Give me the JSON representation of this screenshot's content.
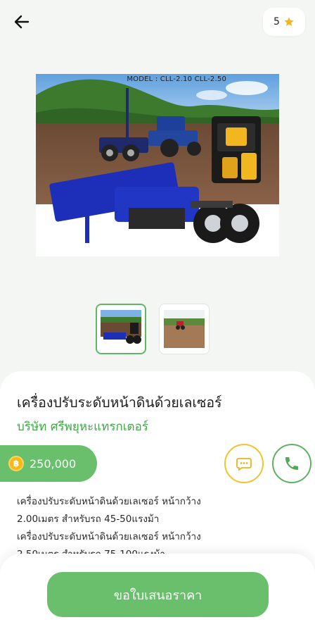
{
  "header": {
    "back_icon": "arrow-left-icon",
    "rating": "5",
    "rating_icon": "star-icon",
    "star_color": "#f2b71f"
  },
  "gallery": {
    "main_image_caption": "MODEL : CLL-2.10   CLL-2.50",
    "thumbnails": [
      {
        "name": "thumbnail-1",
        "active": true
      },
      {
        "name": "thumbnail-2",
        "active": false
      }
    ],
    "active_border_color": "#62b567"
  },
  "product": {
    "title": "เครื่องปรับระดับหน้าดินด้วยเลเซอร์",
    "company": "บริษัท ศรีพยุหะแทรกเตอร์",
    "price": "250,000",
    "price_icon": "coin-icon",
    "description_lines": [
      "เครื่องปรับระดับหน้าดินด้วยเลเซอร์ หน้ากว้าง",
      "2.00เมตร สำหรับรถ 45-50แรงม้า",
      "เครื่องปรับระดับหน้าดินด้วยเลเซอร์ หน้ากว้าง",
      "2.50เมตร สำหรับรถ 75-100แรงม้า"
    ]
  },
  "actions": {
    "chat_icon": "chat-bubble-icon",
    "phone_icon": "phone-icon",
    "cta_label": "ขอใบเสนอราคา"
  },
  "colors": {
    "primary_green": "#6abf6c",
    "company_green": "#43a64a",
    "chat_accent": "#f2c32a"
  }
}
